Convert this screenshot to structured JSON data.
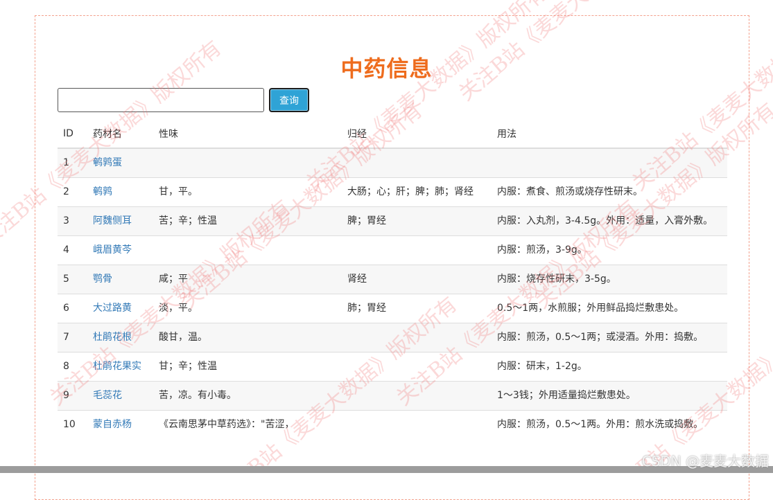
{
  "page": {
    "title": "中药信息"
  },
  "search": {
    "value": "",
    "button_label": "查询"
  },
  "table": {
    "headers": [
      "ID",
      "药材名",
      "性味",
      "归经",
      "用法"
    ],
    "rows": [
      {
        "id": "1",
        "name": "鹌鹑蛋",
        "taste": "",
        "meridian": "",
        "usage": ""
      },
      {
        "id": "2",
        "name": "鹌鹑",
        "taste": "甘，平。",
        "meridian": "大肠；心；肝；脾；肺；肾经",
        "usage": "内服：煮食、煎汤或烧存性研末。"
      },
      {
        "id": "3",
        "name": "阿魏侧耳",
        "taste": "苦；辛；性温",
        "meridian": "脾；胃经",
        "usage": "内服：入丸剂，3-4.5g。外用：适量，入膏外敷。"
      },
      {
        "id": "4",
        "name": "峨眉黄芩",
        "taste": "",
        "meridian": "",
        "usage": "内服：煎汤，3-9g。"
      },
      {
        "id": "5",
        "name": "鹗骨",
        "taste": "咸；平",
        "meridian": "肾经",
        "usage": "内服：烧存性研末，3-5g。"
      },
      {
        "id": "6",
        "name": "大过路黄",
        "taste": "淡，平。",
        "meridian": "肺；胃经",
        "usage": "0.5～1两，水煎服；外用鲜品捣烂敷患处。"
      },
      {
        "id": "7",
        "name": "杜鹃花根",
        "taste": "酸甘，温。",
        "meridian": "",
        "usage": "内服：煎汤，0.5～1两；或浸酒。外用：捣敷。"
      },
      {
        "id": "8",
        "name": "杜鹃花果实",
        "taste": "甘；辛；性温",
        "meridian": "",
        "usage": "内服：研末，1-2g。"
      },
      {
        "id": "9",
        "name": "毛蕊花",
        "taste": "苦，凉。有小毒。",
        "meridian": "",
        "usage": "1～3钱；外用适量捣烂敷患处。"
      },
      {
        "id": "10",
        "name": "蒙自赤杨",
        "taste": "《云南思茅中草药选》：\"苦涩，",
        "meridian": "",
        "usage": "内服：煎汤，0.5～1两。外用：煎水洗或捣敷。"
      }
    ]
  },
  "watermark": {
    "text": "关注B站《麦麦大数据》版权所有",
    "footer": "CSDN @麦麦大数据"
  }
}
